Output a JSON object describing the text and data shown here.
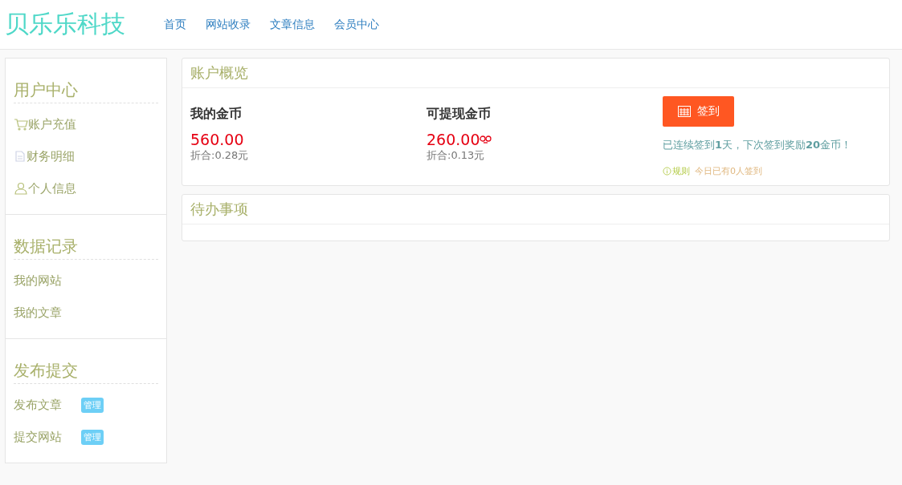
{
  "header": {
    "logo": "贝乐乐科技",
    "nav": [
      {
        "label": "首页"
      },
      {
        "label": "网站收录"
      },
      {
        "label": "文章信息"
      },
      {
        "label": "会员中心"
      }
    ]
  },
  "sidebar": {
    "sections": [
      {
        "title": "用户中心",
        "items": [
          {
            "label": "账户充值",
            "kind": "cart"
          },
          {
            "label": "财务明细",
            "kind": "document"
          },
          {
            "label": "个人信息",
            "kind": "user"
          }
        ]
      },
      {
        "title": "数据记录",
        "items": [
          {
            "label": "我的网站"
          },
          {
            "label": "我的文章"
          }
        ]
      },
      {
        "title": "发布提交",
        "items": [
          {
            "label": "发布文章",
            "badge": "管理"
          },
          {
            "label": "提交网站",
            "badge": "管理"
          }
        ]
      }
    ]
  },
  "overview": {
    "title": "账户概览",
    "stats": [
      {
        "label": "我的金币",
        "amount": "560.00",
        "note": "折合:0.28元",
        "link_icon": false
      },
      {
        "label": "可提现金币",
        "amount": "260.00",
        "note": "折合:0.13元",
        "link_icon": true
      }
    ],
    "checkin": {
      "button": "签到",
      "message": "已连续签到**1**天，下次签到奖励**20**金币！",
      "rules": "规则",
      "today": "今日已有0人签到"
    }
  },
  "todo": {
    "title": "待办事项"
  }
}
